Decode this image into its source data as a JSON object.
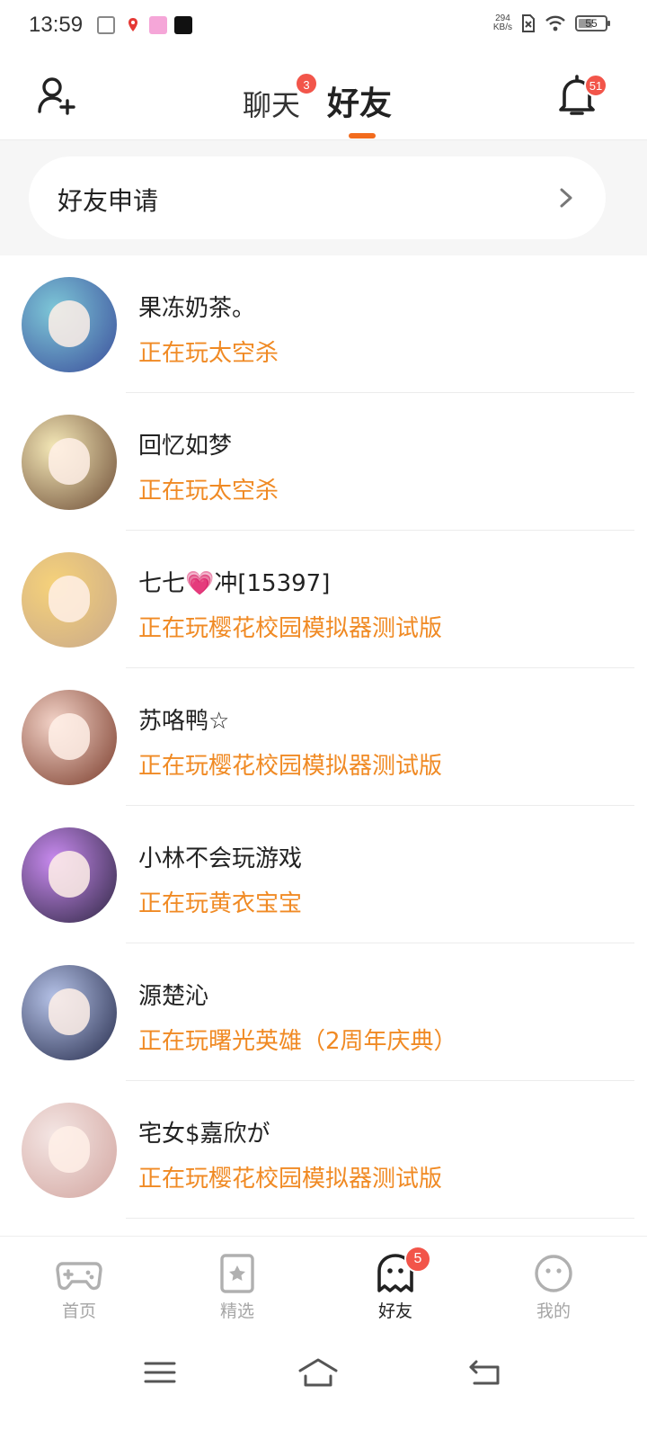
{
  "status_bar": {
    "time": "13:59",
    "net_speed_value": "294",
    "net_speed_unit": "KB/s",
    "battery_level": "55",
    "battery_fraction": 0.55
  },
  "header": {
    "tabs": [
      {
        "label": "聊天",
        "badge": "3",
        "active": false
      },
      {
        "label": "好友",
        "badge": "",
        "active": true
      }
    ],
    "notification_badge": "51"
  },
  "friend_request": {
    "label": "好友申请"
  },
  "friends": [
    {
      "name": "果冻奶茶。",
      "status": "正在玩太空杀",
      "avatar_color_a": "#7ec8d8",
      "avatar_color_b": "#3a4c9a"
    },
    {
      "name": "回忆如梦",
      "status": "正在玩太空杀",
      "avatar_color_a": "#f5e9b8",
      "avatar_color_b": "#6b4a34"
    },
    {
      "name": "七七💗冲[15397]",
      "status": "正在玩樱花校园模拟器测试版",
      "avatar_color_a": "#f6d27a",
      "avatar_color_b": "#c9a98a"
    },
    {
      "name": "苏咯鸭☆",
      "status": "正在玩樱花校园模拟器测试版",
      "avatar_color_a": "#f3d3c8",
      "avatar_color_b": "#7a3b2a"
    },
    {
      "name": "小林不会玩游戏",
      "status": "正在玩黄衣宝宝",
      "avatar_color_a": "#c98bf0",
      "avatar_color_b": "#2c2540"
    },
    {
      "name": "源楚沁",
      "status": "正在玩曙光英雄（2周年庆典）",
      "avatar_color_a": "#b6c3e8",
      "avatar_color_b": "#242a4a"
    },
    {
      "name": "宅女$嘉欣が",
      "status": "正在玩樱花校园模拟器测试版",
      "avatar_color_a": "#f4e6e4",
      "avatar_color_b": "#d2a59f"
    }
  ],
  "bottom_nav": [
    {
      "label": "首页",
      "icon": "gamepad-icon",
      "active": false,
      "badge": ""
    },
    {
      "label": "精选",
      "icon": "star-card-icon",
      "active": false,
      "badge": ""
    },
    {
      "label": "好友",
      "icon": "ghost-icon",
      "active": true,
      "badge": "5"
    },
    {
      "label": "我的",
      "icon": "smiley-icon",
      "active": false,
      "badge": ""
    }
  ],
  "colors": {
    "accent": "#f26b1d",
    "status_text": "#f08a24",
    "badge": "#f2554a",
    "inactive": "#a6a6a6"
  }
}
